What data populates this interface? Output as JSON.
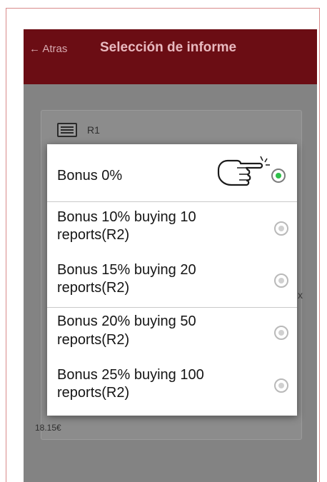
{
  "appbar": {
    "back_label": "← Atras",
    "title": "Selección de informe"
  },
  "background": {
    "report_item": "R1",
    "price": "18.15€",
    "close_glyph": "x"
  },
  "dialog": {
    "options": [
      {
        "label_line1": "Bonus 0%",
        "label_line2": "",
        "selected": true
      },
      {
        "label_line1": "Bonus 10% buying 10",
        "label_line2": "reports(R2)",
        "selected": false
      },
      {
        "label_line1": "Bonus 15% buying 20",
        "label_line2": "reports(R2)",
        "selected": false
      },
      {
        "label_line1": "Bonus 20% buying 50",
        "label_line2": "reports(R2)",
        "selected": false
      },
      {
        "label_line1": "Bonus 25% buying 100",
        "label_line2": "reports(R2)",
        "selected": false
      }
    ]
  },
  "colors": {
    "appbar": "#6b0d14",
    "selected_radio": "#2ec04a",
    "overlay": "#838383"
  },
  "icons": {
    "pointer": "pointing-hand-icon",
    "list": "list-icon"
  }
}
